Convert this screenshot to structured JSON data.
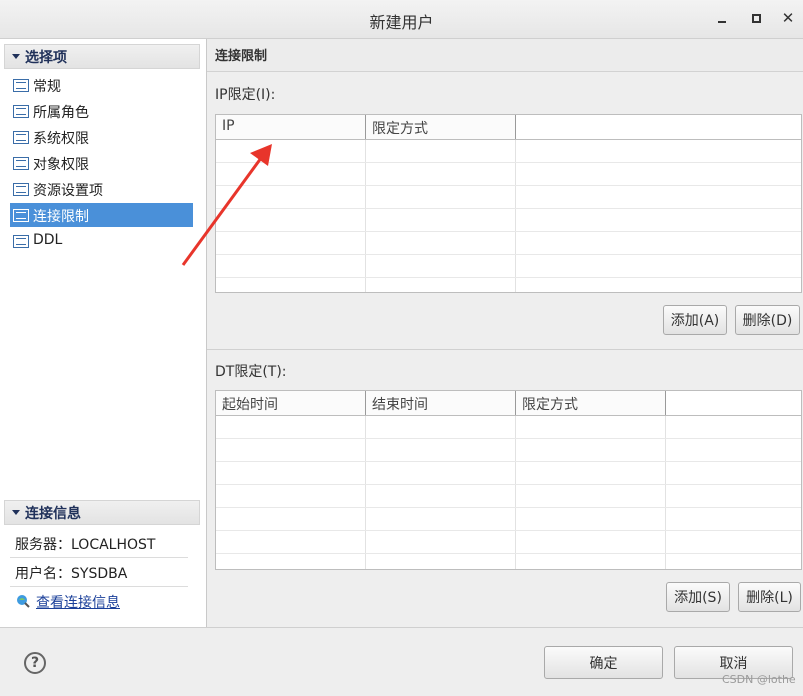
{
  "window": {
    "title": "新建用户",
    "close_glyph": "✕"
  },
  "left": {
    "options_header": "选择项",
    "nav_items": [
      {
        "label": "常规",
        "icon": "list-icon"
      },
      {
        "label": "所属角色",
        "icon": "list-icon"
      },
      {
        "label": "系统权限",
        "icon": "list-icon"
      },
      {
        "label": "对象权限",
        "icon": "list-icon"
      },
      {
        "label": "资源设置项",
        "icon": "list-icon"
      },
      {
        "label": "连接限制",
        "icon": "list-icon",
        "selected": true
      },
      {
        "label": "DDL",
        "icon": "list-icon"
      }
    ],
    "conn_header": "连接信息",
    "server": "服务器：LOCALHOST",
    "username": "用户名：SYSDBA",
    "view_link": "查看连接信息"
  },
  "right": {
    "header": "连接限制",
    "ip_label": "IP限定(I):",
    "ip_columns": [
      "IP",
      "限定方式"
    ],
    "ip_add": "添加(A)",
    "ip_delete": "删除(D)",
    "dt_label": "DT限定(T):",
    "dt_columns": [
      "起始时间",
      "结束时间",
      "限定方式"
    ],
    "dt_add": "添加(S)",
    "dt_delete": "删除(L)"
  },
  "footer": {
    "ok": "确定",
    "cancel": "取消",
    "help_glyph": "?",
    "watermark": "CSDN @lothe"
  },
  "colors": {
    "selection": "#4a90d9",
    "annotation_arrow": "#e8352b",
    "link": "#1a3f99"
  }
}
